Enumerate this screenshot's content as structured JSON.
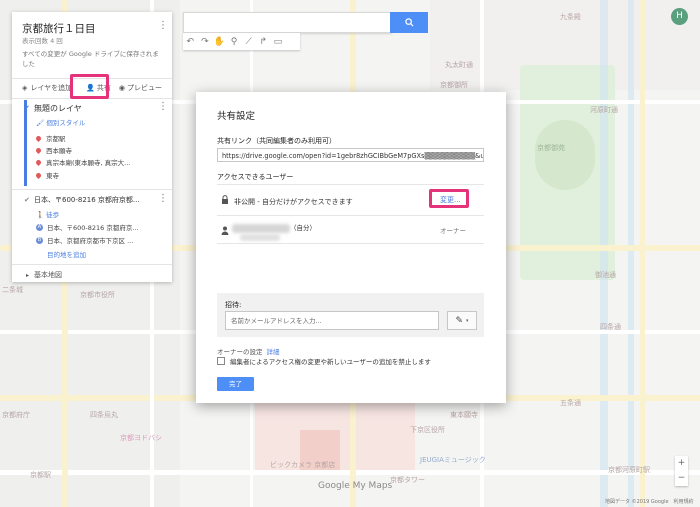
{
  "map_name": "京都旅行１日目",
  "map_views": "表示回数 4 回",
  "map_saved_note": "すべての変更が Google ドライブに保存されました",
  "actions": {
    "add_layer": "レイヤを追加",
    "share": "共有",
    "preview": "プレビュー"
  },
  "layer1": {
    "title": "無題のレイヤ",
    "style": "個別スタイル",
    "items": [
      "京都駅",
      "西本願寺",
      "真宗本廟(東本願寺, 真宗大...",
      "東寺"
    ]
  },
  "layer2": {
    "title": "日本、〒600-8216 京都府京都...",
    "mode": "徒歩",
    "stop_a": "日本、〒600-8216 京都府京...",
    "stop_b": "日本、京都府京都市下京区 ...",
    "add_destination": "目的地を追加"
  },
  "base_map": "基本地図",
  "avatar_letter": "H",
  "dialog": {
    "title": "共有設定",
    "link_label": "共有リンク（共同編集者のみ利用可）",
    "link_value": "https://drive.google.com/open?id=1gebr8zhGCIBbGeM7pGXs▒▒▒▒▒▒▒▒▒▒&usp=sha",
    "access_label": "アクセスできるユーザー",
    "access_text": "非公開 - 自分だけがアクセスできます",
    "change_link": "変更...",
    "self_label": "（自分）",
    "owner_role": "オーナー",
    "invite_label": "招待:",
    "invite_placeholder": "名前かメールアドレスを入力...",
    "owner_settings": "オーナーの設定",
    "details_link": "詳細",
    "checkbox_label": "編集者によるアクセス権の変更や新しいユーザーの追加を禁止します",
    "done_button": "完了"
  },
  "map_labels": [
    "京都御苑",
    "九条殿",
    "丸太町通",
    "京都御所",
    "河原町通",
    "二条通",
    "御池通",
    "三条通",
    "四条通",
    "五条通",
    "七条通",
    "八条通",
    "京都駅",
    "京都タワー",
    "西洞院通",
    "堀川通",
    "京都市役所",
    "京都府庁",
    "京都中央郵便局",
    "ビックカメラ 京都店",
    "京都ヨドバシ",
    "JEUGIAミュージック",
    "四条烏丸",
    "下京区役所",
    "東本願寺",
    "西本願寺",
    "梅小路公園",
    "二条城",
    "京都国際マンガミュージアム",
    "東山駅",
    "祇園四条駅",
    "京都河原町駅"
  ],
  "footer": "地図データ ©2019 Google　利用規約",
  "logo_text": "Google My Maps",
  "colors": {
    "accent": "#4d8ef7",
    "highlight": "#e4337a",
    "pin": "#e05a5a",
    "style_link": "#4a7de2"
  }
}
